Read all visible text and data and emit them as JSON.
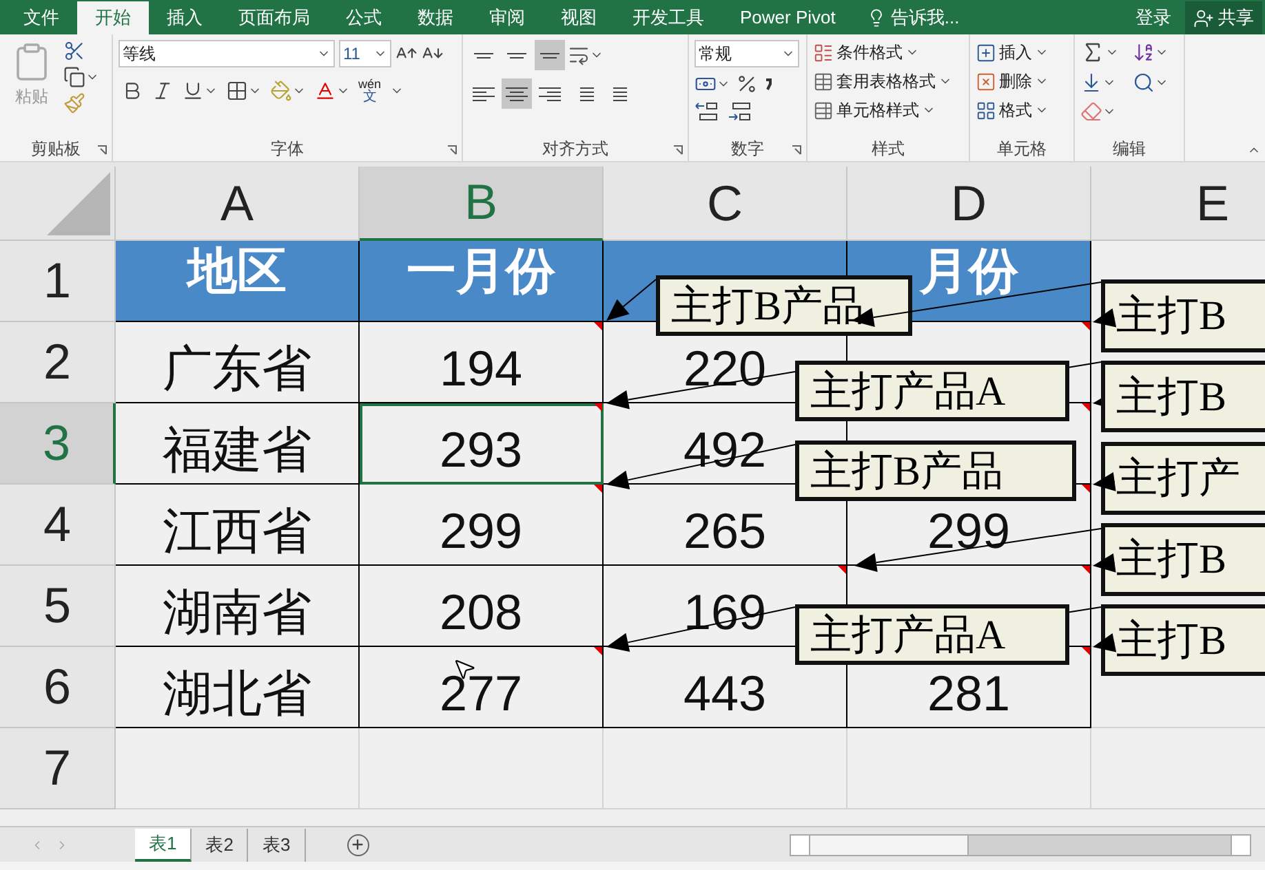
{
  "ribbon_tabs": [
    {
      "label": "文件",
      "selected": false
    },
    {
      "label": "开始",
      "selected": true
    },
    {
      "label": "插入",
      "selected": false
    },
    {
      "label": "页面布局",
      "selected": false
    },
    {
      "label": "公式",
      "selected": false
    },
    {
      "label": "数据",
      "selected": false
    },
    {
      "label": "审阅",
      "selected": false
    },
    {
      "label": "视图",
      "selected": false
    },
    {
      "label": "开发工具",
      "selected": false
    },
    {
      "label": "Power Pivot",
      "selected": false
    }
  ],
  "tell_me": "告诉我...",
  "sign_in": "登录",
  "share": "共享",
  "clipboard": {
    "paste": "粘贴",
    "label": "剪贴板"
  },
  "font": {
    "name": "等线",
    "size": "11",
    "phonetic_top": "wén",
    "phonetic_bottom": "文",
    "label": "字体"
  },
  "alignment": {
    "vertical": [
      {
        "selected": false
      },
      {
        "selected": false
      },
      {
        "selected": true
      }
    ],
    "horizontal": [
      {
        "selected": false
      },
      {
        "selected": true
      },
      {
        "selected": false
      }
    ],
    "label": "对齐方式"
  },
  "number": {
    "format": "常规",
    "label": "数字"
  },
  "styles": {
    "items": [
      "条件格式",
      "套用表格格式",
      "单元格样式"
    ],
    "label": "样式"
  },
  "cells_group": {
    "items": [
      "插入",
      "删除",
      "格式"
    ],
    "label": "单元格"
  },
  "editing": {
    "label": "编辑"
  },
  "columns": [
    {
      "label": "A",
      "selected": false
    },
    {
      "label": "B",
      "selected": true
    },
    {
      "label": "C",
      "selected": false
    },
    {
      "label": "D",
      "selected": false
    },
    {
      "label": "E",
      "selected": false
    }
  ],
  "rows": [
    {
      "label": "1",
      "selected": false,
      "kind": "header",
      "cells": [
        {
          "text": "地区",
          "selected": false
        },
        {
          "text": "一月份",
          "selected": false
        },
        {
          "selected": false
        },
        {
          "text": "月份",
          "selected": false
        }
      ]
    },
    {
      "label": "2",
      "selected": false,
      "kind": "data",
      "cells": [
        {
          "text": "广东省",
          "selected": false
        },
        {
          "text": "194",
          "selected": false
        },
        {
          "text": "220",
          "selected": false
        },
        {
          "selected": false
        }
      ]
    },
    {
      "label": "3",
      "selected": true,
      "kind": "data",
      "cells": [
        {
          "text": "福建省",
          "selected": false
        },
        {
          "text": "293",
          "selected": true
        },
        {
          "text": "492",
          "selected": false
        },
        {
          "selected": false
        }
      ]
    },
    {
      "label": "4",
      "selected": false,
      "kind": "data",
      "cells": [
        {
          "text": "江西省",
          "selected": false
        },
        {
          "text": "299",
          "selected": false
        },
        {
          "text": "265",
          "selected": false
        },
        {
          "text": "299",
          "selected": false
        }
      ]
    },
    {
      "label": "5",
      "selected": false,
      "kind": "data",
      "cells": [
        {
          "text": "湖南省",
          "selected": false
        },
        {
          "text": "208",
          "selected": false
        },
        {
          "text": "169",
          "selected": false
        },
        {
          "selected": false
        }
      ]
    },
    {
      "label": "6",
      "selected": false,
      "kind": "data",
      "cells": [
        {
          "text": "湖北省",
          "selected": false
        },
        {
          "text": "277",
          "selected": false
        },
        {
          "text": "443",
          "selected": false
        },
        {
          "text": "281",
          "selected": false
        }
      ]
    },
    {
      "label": "7",
      "selected": false,
      "kind": "empty"
    }
  ],
  "comments": [
    {
      "text": "主打B产品"
    },
    {
      "text": "主打产品A"
    },
    {
      "text": "主打B产品"
    },
    {
      "text": "主打产品A"
    },
    {
      "text": "主打B"
    },
    {
      "text": "主打B"
    },
    {
      "text": "主打产"
    },
    {
      "text": "主打B"
    },
    {
      "text": "主打B"
    }
  ],
  "sheets": [
    {
      "label": "表1",
      "selected": true
    },
    {
      "label": "表2",
      "selected": false
    },
    {
      "label": "表3",
      "selected": false
    }
  ]
}
